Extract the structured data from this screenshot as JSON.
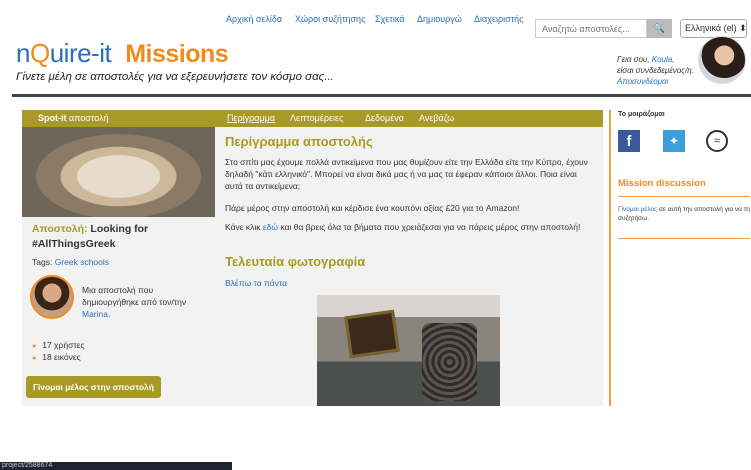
{
  "topnav": {
    "home": "Αρχική σελίδα",
    "forums": "Χώροι συζήτησης",
    "about": "Σχετικά",
    "create": "Δημιουργώ",
    "admin": "Διαχειριστής",
    "search_placeholder": "Αναζητώ αποστολές...",
    "search_button_icon": "search-icon",
    "language": "Ελληνικά (el) ⬍"
  },
  "header": {
    "logo_n": "n",
    "logo_q": "Q",
    "logo_rest": "uire-it",
    "logo_missions": "Missions",
    "tagline": "Γίνετε μέλη σε αποστολές για να εξερευνήσετε τον κόσμο σας...",
    "greet_prefix": "Γεια σου, ",
    "user_name": "Koula",
    "greet_suffix": ",",
    "logged_in_text": "είσαι συνδεδεμένος/η.",
    "logout": "Αποσυνδέομαι"
  },
  "mission": {
    "type_label_bold": "Spot-it",
    "type_label": " αποστολή",
    "tabs": [
      "Περίγραμμα",
      "Λεπτομέρειες",
      "Δεδομένα",
      "Ανεβάζω"
    ],
    "title_prefix": "Αποστολή:",
    "title": " Looking for #AllThingsGreek",
    "tags_label": "Tags: ",
    "tag": "Greek schools",
    "creator_text": "Μια αποστολή που δημιουργήθηκε από τον/την ",
    "creator_name": "Marina",
    "creator_end": ".",
    "stats": [
      "17 χρήστες",
      "18 εικόνες"
    ],
    "join_button": "Γίνομαι μέλος στην αποστολή",
    "outline_heading": "Περίγραμμα αποστολής",
    "para1": "Στο σπίτι μας έχουμε πολλά αντικείμενα που μας θυμίζουν είτε την Ελλάδα είτε την Κύπρο, έχουν δηλαδή \"κάτι ελληνικό\". Μπορεί να είναι δικά μας ή να μας τα έφεραν κάποιοι άλλοι. Ποια είναι αυτά τα αντικείμενα;",
    "para2": "Πάρε μέρος στην αποστολή και κέρδισε ένα κουπόνι αξίας £20 για το Amazon!",
    "para3_a": "Κάνε κλικ ",
    "para3_link": "εδώ",
    "para3_b": " και θα βρεις όλα τα βήματα που χρειάζεσαι για να πάρεις μέρος στην αποστολή!",
    "latest_heading": "Τελευταία φωτογραφία",
    "view_all": "Βλέπω τα πάντα"
  },
  "sidebar": {
    "share_heading": "Το μοιράζομαι",
    "share_icons": [
      "facebook-icon",
      "twitter-icon",
      "other-share-icon"
    ],
    "discussion_heading": "Mission discussion",
    "discussion_link": "Γίνομαι μέλος",
    "discussion_text": " σε αυτή την αποστολή για να τη συζητήσω."
  },
  "statusbar": {
    "url": "project/2588674"
  },
  "colors": {
    "accent_olive": "#a89a24",
    "accent_orange": "#f18a1d",
    "link_blue": "#2a6fb8"
  }
}
